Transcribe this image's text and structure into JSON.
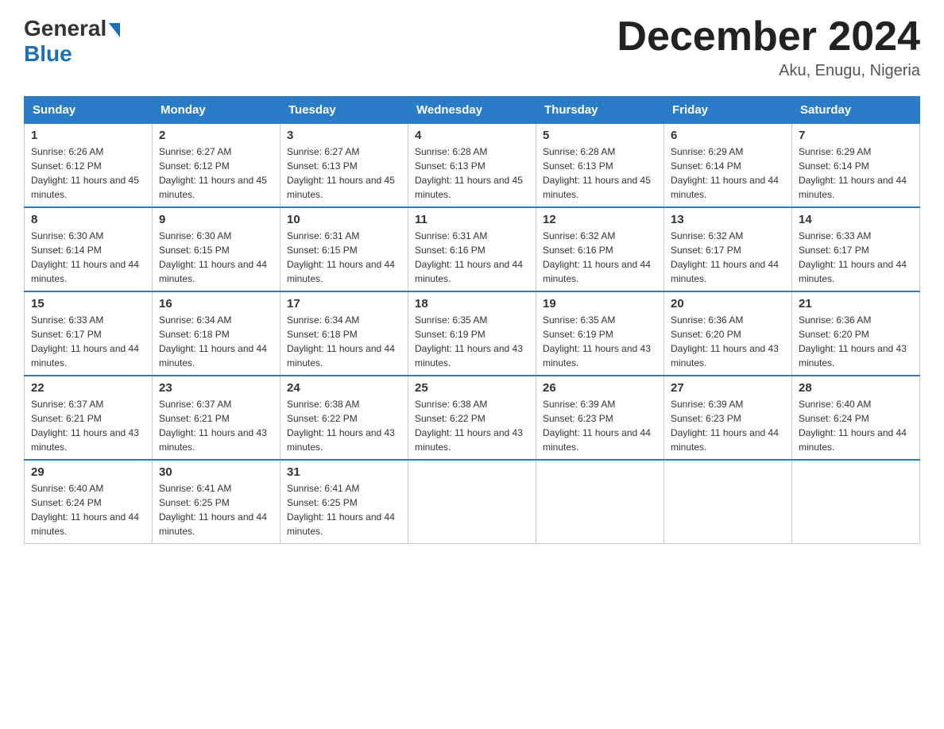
{
  "logo": {
    "general": "General",
    "blue": "Blue",
    "arrow": "▶"
  },
  "title": "December 2024",
  "location": "Aku, Enugu, Nigeria",
  "days_of_week": [
    "Sunday",
    "Monday",
    "Tuesday",
    "Wednesday",
    "Thursday",
    "Friday",
    "Saturday"
  ],
  "weeks": [
    [
      {
        "day": "1",
        "sunrise": "6:26 AM",
        "sunset": "6:12 PM",
        "daylight": "11 hours and 45 minutes."
      },
      {
        "day": "2",
        "sunrise": "6:27 AM",
        "sunset": "6:12 PM",
        "daylight": "11 hours and 45 minutes."
      },
      {
        "day": "3",
        "sunrise": "6:27 AM",
        "sunset": "6:13 PM",
        "daylight": "11 hours and 45 minutes."
      },
      {
        "day": "4",
        "sunrise": "6:28 AM",
        "sunset": "6:13 PM",
        "daylight": "11 hours and 45 minutes."
      },
      {
        "day": "5",
        "sunrise": "6:28 AM",
        "sunset": "6:13 PM",
        "daylight": "11 hours and 45 minutes."
      },
      {
        "day": "6",
        "sunrise": "6:29 AM",
        "sunset": "6:14 PM",
        "daylight": "11 hours and 44 minutes."
      },
      {
        "day": "7",
        "sunrise": "6:29 AM",
        "sunset": "6:14 PM",
        "daylight": "11 hours and 44 minutes."
      }
    ],
    [
      {
        "day": "8",
        "sunrise": "6:30 AM",
        "sunset": "6:14 PM",
        "daylight": "11 hours and 44 minutes."
      },
      {
        "day": "9",
        "sunrise": "6:30 AM",
        "sunset": "6:15 PM",
        "daylight": "11 hours and 44 minutes."
      },
      {
        "day": "10",
        "sunrise": "6:31 AM",
        "sunset": "6:15 PM",
        "daylight": "11 hours and 44 minutes."
      },
      {
        "day": "11",
        "sunrise": "6:31 AM",
        "sunset": "6:16 PM",
        "daylight": "11 hours and 44 minutes."
      },
      {
        "day": "12",
        "sunrise": "6:32 AM",
        "sunset": "6:16 PM",
        "daylight": "11 hours and 44 minutes."
      },
      {
        "day": "13",
        "sunrise": "6:32 AM",
        "sunset": "6:17 PM",
        "daylight": "11 hours and 44 minutes."
      },
      {
        "day": "14",
        "sunrise": "6:33 AM",
        "sunset": "6:17 PM",
        "daylight": "11 hours and 44 minutes."
      }
    ],
    [
      {
        "day": "15",
        "sunrise": "6:33 AM",
        "sunset": "6:17 PM",
        "daylight": "11 hours and 44 minutes."
      },
      {
        "day": "16",
        "sunrise": "6:34 AM",
        "sunset": "6:18 PM",
        "daylight": "11 hours and 44 minutes."
      },
      {
        "day": "17",
        "sunrise": "6:34 AM",
        "sunset": "6:18 PM",
        "daylight": "11 hours and 44 minutes."
      },
      {
        "day": "18",
        "sunrise": "6:35 AM",
        "sunset": "6:19 PM",
        "daylight": "11 hours and 43 minutes."
      },
      {
        "day": "19",
        "sunrise": "6:35 AM",
        "sunset": "6:19 PM",
        "daylight": "11 hours and 43 minutes."
      },
      {
        "day": "20",
        "sunrise": "6:36 AM",
        "sunset": "6:20 PM",
        "daylight": "11 hours and 43 minutes."
      },
      {
        "day": "21",
        "sunrise": "6:36 AM",
        "sunset": "6:20 PM",
        "daylight": "11 hours and 43 minutes."
      }
    ],
    [
      {
        "day": "22",
        "sunrise": "6:37 AM",
        "sunset": "6:21 PM",
        "daylight": "11 hours and 43 minutes."
      },
      {
        "day": "23",
        "sunrise": "6:37 AM",
        "sunset": "6:21 PM",
        "daylight": "11 hours and 43 minutes."
      },
      {
        "day": "24",
        "sunrise": "6:38 AM",
        "sunset": "6:22 PM",
        "daylight": "11 hours and 43 minutes."
      },
      {
        "day": "25",
        "sunrise": "6:38 AM",
        "sunset": "6:22 PM",
        "daylight": "11 hours and 43 minutes."
      },
      {
        "day": "26",
        "sunrise": "6:39 AM",
        "sunset": "6:23 PM",
        "daylight": "11 hours and 44 minutes."
      },
      {
        "day": "27",
        "sunrise": "6:39 AM",
        "sunset": "6:23 PM",
        "daylight": "11 hours and 44 minutes."
      },
      {
        "day": "28",
        "sunrise": "6:40 AM",
        "sunset": "6:24 PM",
        "daylight": "11 hours and 44 minutes."
      }
    ],
    [
      {
        "day": "29",
        "sunrise": "6:40 AM",
        "sunset": "6:24 PM",
        "daylight": "11 hours and 44 minutes."
      },
      {
        "day": "30",
        "sunrise": "6:41 AM",
        "sunset": "6:25 PM",
        "daylight": "11 hours and 44 minutes."
      },
      {
        "day": "31",
        "sunrise": "6:41 AM",
        "sunset": "6:25 PM",
        "daylight": "11 hours and 44 minutes."
      },
      null,
      null,
      null,
      null
    ]
  ],
  "labels": {
    "sunrise": "Sunrise:",
    "sunset": "Sunset:",
    "daylight": "Daylight:"
  }
}
